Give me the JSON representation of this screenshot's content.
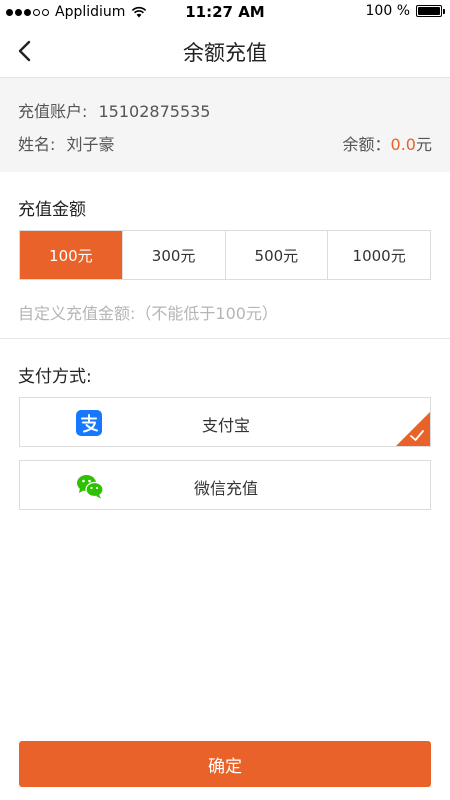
{
  "status_bar": {
    "carrier": "Applidium",
    "time": "11:27 AM",
    "battery": "100 %"
  },
  "header": {
    "title": "余额充值"
  },
  "account": {
    "account_label": "充值账户:",
    "account_value": "15102875535",
    "name_label": "姓名:",
    "name_value": "刘子豪",
    "balance_label": "余额：",
    "balance_value": "0.0",
    "balance_unit": "元"
  },
  "amount_section": {
    "title": "充值金额",
    "options": [
      {
        "label": "100元",
        "selected": true
      },
      {
        "label": "300元",
        "selected": false
      },
      {
        "label": "500元",
        "selected": false
      },
      {
        "label": "1000元",
        "selected": false
      }
    ],
    "custom_placeholder": "自定义充值金额:（不能低于100元）"
  },
  "payment_section": {
    "title": "支付方式:",
    "methods": [
      {
        "label": "支付宝",
        "icon": "alipay-icon",
        "selected": true
      },
      {
        "label": "微信充值",
        "icon": "wechat-icon",
        "selected": false
      }
    ]
  },
  "confirm": {
    "label": "确定"
  },
  "colors": {
    "accent": "#e8622a",
    "alipay": "#1677ff",
    "wechat": "#2dc100"
  }
}
